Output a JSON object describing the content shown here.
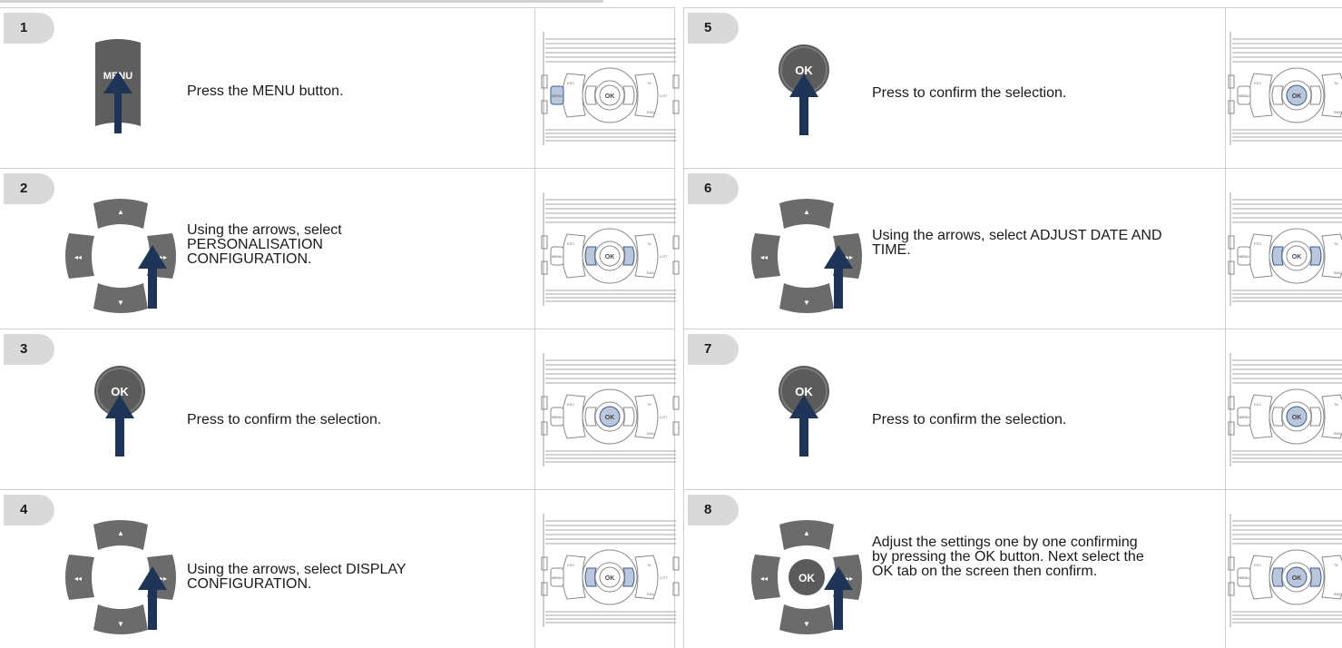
{
  "steps": [
    {
      "number": "1",
      "text": "Press the MENU button.",
      "graphic": "menu-button",
      "highlight": "menu"
    },
    {
      "number": "2",
      "text": "Using the arrows, select PERSONALISATION CONFIGURATION.",
      "graphic": "arrow-pad",
      "highlight": "arrows"
    },
    {
      "number": "3",
      "text": "Press to confirm the selection.",
      "graphic": "ok-button",
      "highlight": "ok"
    },
    {
      "number": "4",
      "text": "Using the arrows, select DISPLAY CONFIGURATION.",
      "graphic": "arrow-pad",
      "highlight": "arrows"
    },
    {
      "number": "5",
      "text": "Press to confirm the selection.",
      "graphic": "ok-button",
      "highlight": "ok"
    },
    {
      "number": "6",
      "text": "Using the arrows, select ADJUST DATE AND TIME.",
      "graphic": "arrow-pad",
      "highlight": "arrows"
    },
    {
      "number": "7",
      "text": "Press to confirm the selection.",
      "graphic": "ok-button",
      "highlight": "ok"
    },
    {
      "number": "8",
      "text": "Adjust the settings one by one confirming by pressing the OK button. Next select the OK tab on the screen then confirm.",
      "graphic": "arrow-pad-ok",
      "highlight": "arrows-ok"
    }
  ],
  "labels": {
    "menu": "MENU",
    "ok": "OK",
    "esc": "ESC",
    "ta": "TA",
    "list": "LIST",
    "band": "BND"
  },
  "colors": {
    "highlight": "#b9c6dc",
    "highlight_stroke": "#3a5a8c",
    "arrow": "#1f3558",
    "button_dark": "#5b5b5b",
    "badge": "#d9d9d9"
  }
}
